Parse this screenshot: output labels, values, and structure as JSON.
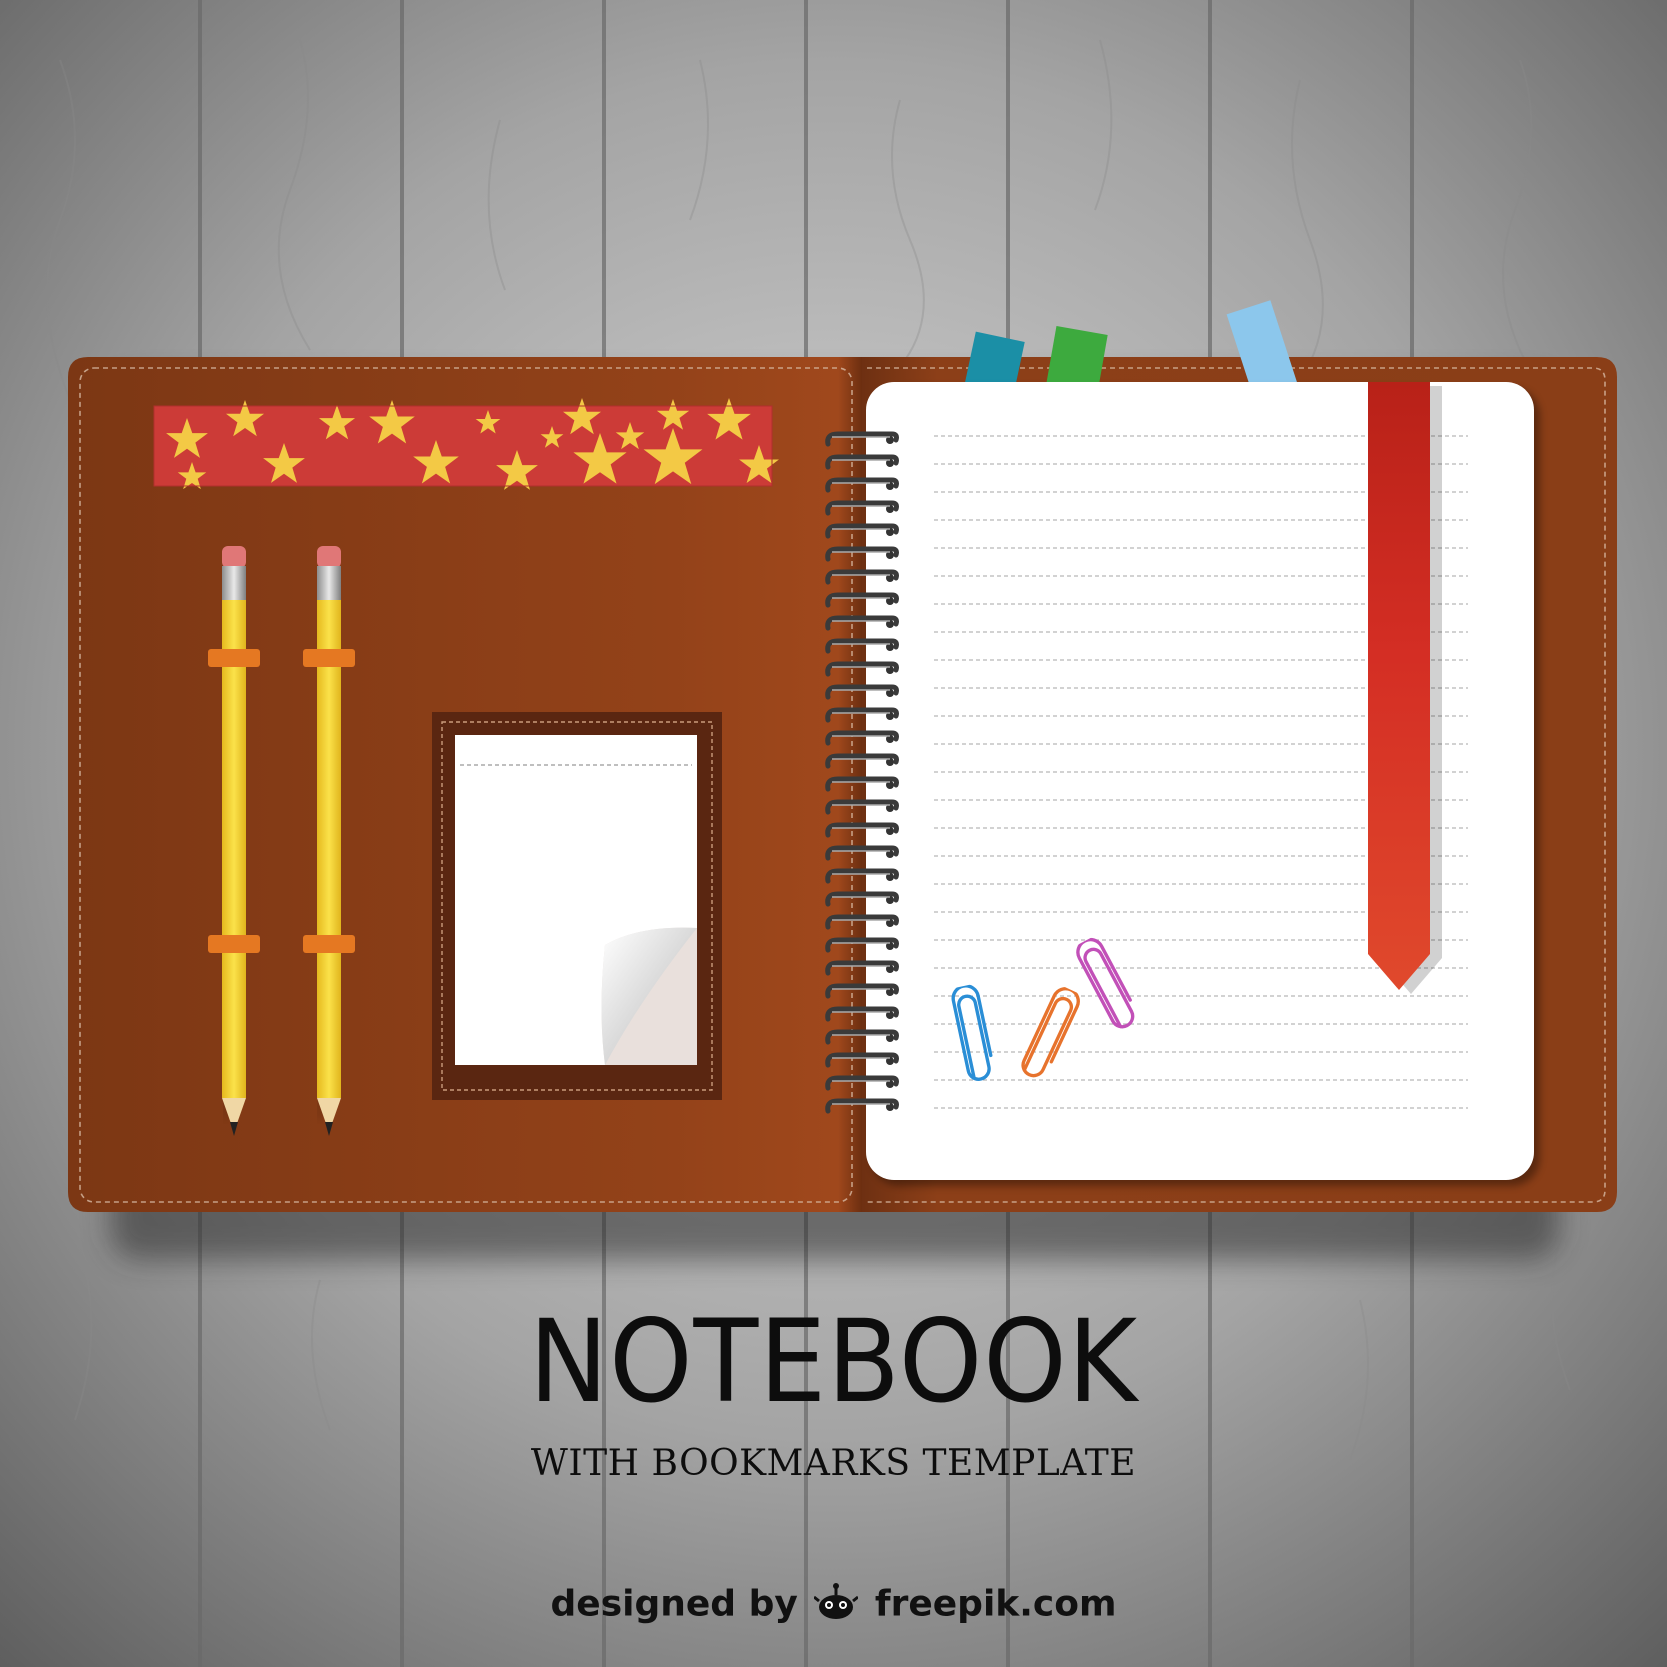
{
  "title": "NOTEBOOK",
  "subtitle": "WITH BOOKMARKS TEMPLATE",
  "credit": {
    "prefix": "designed by",
    "brand": "freepik.com",
    "logo_icon": "freepik-bug-icon"
  },
  "colors": {
    "background_wood": "#8f8f8f",
    "leather": "#8a3f16",
    "leather_dark": "#6e2f10",
    "page": "#ffffff",
    "ribbon": "#c7271c",
    "tab_teal": "#1b8fa6",
    "tab_green": "#3daa3e",
    "tab_blue": "#8cc7ec",
    "washi_tape": "#cc3b37",
    "stars": "#f3c945",
    "pencil": "#f3d32e",
    "clip_blue": "#2a8ed6",
    "clip_orange": "#e7732d",
    "clip_pink": "#c250b8",
    "title_text": "#0d0d0d"
  },
  "icons": [
    "star-icon",
    "pencil-icon",
    "paperclip-icon",
    "spiral-ring-icon",
    "freepik-bug-icon"
  ]
}
